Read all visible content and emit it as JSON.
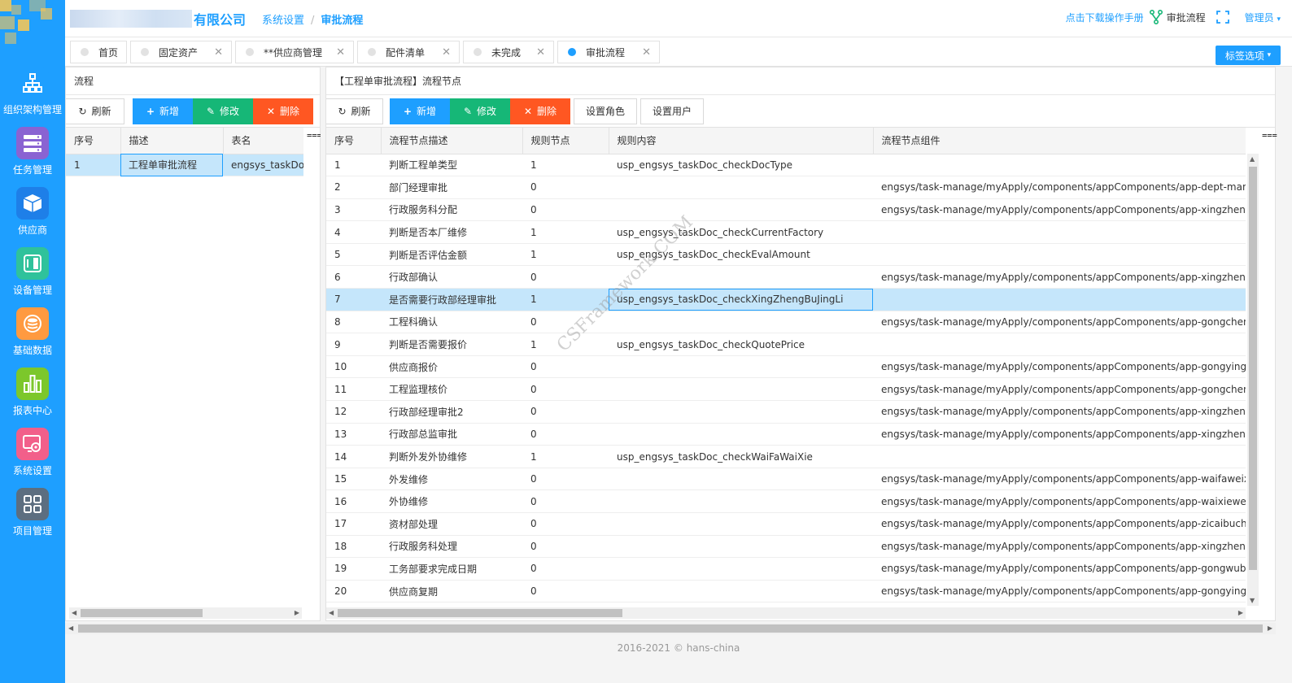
{
  "header": {
    "company": "有限公司",
    "breadcrumb": [
      "系统设置",
      "审批流程"
    ],
    "manual_link": "点击下载操作手册",
    "current_flow": "审批流程",
    "user": "管理员"
  },
  "nav": [
    {
      "label": "组织架构管理",
      "icon": "org-chart-icon",
      "color": "#1E9FFF"
    },
    {
      "label": "任务管理",
      "icon": "list-icon",
      "color": "#8a63d2"
    },
    {
      "label": "供应商",
      "icon": "box-icon",
      "color": "#1E7FE8"
    },
    {
      "label": "设备管理",
      "icon": "device-icon",
      "color": "#2fc29b"
    },
    {
      "label": "基础数据",
      "icon": "database-icon",
      "color": "#ff9a40"
    },
    {
      "label": "报表中心",
      "icon": "bar-chart-icon",
      "color": "#7cc72b"
    },
    {
      "label": "系统设置",
      "icon": "settings-icon",
      "color": "#f25f8a"
    },
    {
      "label": "项目管理",
      "icon": "grid-icon",
      "color": "#5c6e80"
    }
  ],
  "tabs": [
    {
      "label": "首页",
      "closable": false
    },
    {
      "label": "固定资产",
      "closable": true
    },
    {
      "label": "**供应商管理",
      "closable": true
    },
    {
      "label": "配件清单",
      "closable": true
    },
    {
      "label": "未完成",
      "closable": true
    },
    {
      "label": "审批流程",
      "closable": true,
      "active": true
    }
  ],
  "tag_options": "标签选项",
  "left_panel": {
    "title": "流程",
    "buttons": {
      "refresh": "刷新",
      "add": "新增",
      "edit": "修改",
      "delete": "删除"
    },
    "columns": [
      "序号",
      "描述",
      "表名"
    ],
    "rows": [
      [
        "1",
        "工程单审批流程",
        "engsys_taskDoc"
      ]
    ]
  },
  "right_panel": {
    "title": "【工程单审批流程】流程节点",
    "buttons": {
      "refresh": "刷新",
      "add": "新增",
      "edit": "修改",
      "delete": "删除",
      "set_role": "设置角色",
      "set_user": "设置用户"
    },
    "columns": [
      "序号",
      "流程节点描述",
      "规则节点",
      "规则内容",
      "流程节点组件"
    ],
    "rows": [
      [
        "1",
        "判断工程单类型",
        "1",
        "usp_engsys_taskDoc_checkDocType",
        ""
      ],
      [
        "2",
        "部门经理审批",
        "0",
        "",
        "engsys/task-manage/myApply/components/appComponents/app-dept-manage.vue"
      ],
      [
        "3",
        "行政服务科分配",
        "0",
        "",
        "engsys/task-manage/myApply/components/appComponents/app-xingzhengfuwukefe"
      ],
      [
        "4",
        "判断是否本厂维修",
        "1",
        "usp_engsys_taskDoc_checkCurrentFactory",
        ""
      ],
      [
        "5",
        "判断是否评估金额",
        "1",
        "usp_engsys_taskDoc_checkEvalAmount",
        ""
      ],
      [
        "6",
        "行政部确认",
        "0",
        "",
        "engsys/task-manage/myApply/components/appComponents/app-xingzhengbu-quer"
      ],
      [
        "7",
        "是否需要行政部经理审批",
        "1",
        "usp_engsys_taskDoc_checkXingZhengBuJingLi",
        ""
      ],
      [
        "8",
        "工程科确认",
        "0",
        "",
        "engsys/task-manage/myApply/components/appComponents/app-gongchengke-que"
      ],
      [
        "9",
        "判断是否需要报价",
        "1",
        "usp_engsys_taskDoc_checkQuotePrice",
        ""
      ],
      [
        "10",
        "供应商报价",
        "0",
        "",
        "engsys/task-manage/myApply/components/appComponents/app-gongyingshangbao"
      ],
      [
        "11",
        "工程监理核价",
        "0",
        "",
        "engsys/task-manage/myApply/components/appComponents/app-gongchengjianli-he"
      ],
      [
        "12",
        "行政部经理审批2",
        "0",
        "",
        "engsys/task-manage/myApply/components/appComponents/app-xingzhengbu-jingli"
      ],
      [
        "13",
        "行政部总监审批",
        "0",
        "",
        "engsys/task-manage/myApply/components/appComponents/app-xingzhengbu-zong"
      ],
      [
        "14",
        "判断外发外协维修",
        "1",
        "usp_engsys_taskDoc_checkWaiFaWaiXie",
        ""
      ],
      [
        "15",
        "外发维修",
        "0",
        "",
        "engsys/task-manage/myApply/components/appComponents/app-waifaweixiu.vue"
      ],
      [
        "16",
        "外协维修",
        "0",
        "",
        "engsys/task-manage/myApply/components/appComponents/app-waixieweixiu.vue"
      ],
      [
        "17",
        "资材部处理",
        "0",
        "",
        "engsys/task-manage/myApply/components/appComponents/app-zicaibuchuli.vue"
      ],
      [
        "18",
        "行政服务科处理",
        "0",
        "",
        "engsys/task-manage/myApply/components/appComponents/app-xingzhengbu-fuwu"
      ],
      [
        "19",
        "工务部要求完成日期",
        "0",
        "",
        "engsys/task-manage/myApply/components/appComponents/app-gongwubuyaoqiuw"
      ],
      [
        "20",
        "供应商复期",
        "0",
        "",
        "engsys/task-manage/myApply/components/appComponents/app-gongyingshangfuq"
      ]
    ]
  },
  "footer": "2016-2021 © hans-china",
  "watermark": "CSFramework.COM"
}
